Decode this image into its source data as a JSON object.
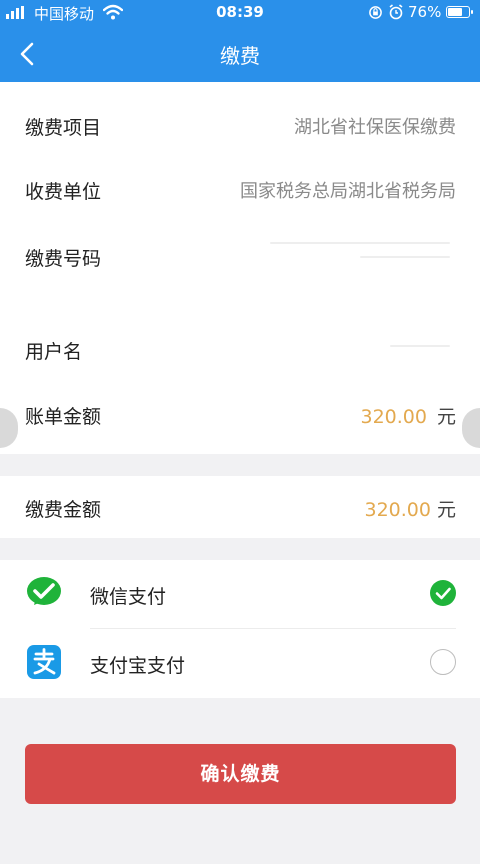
{
  "status_bar": {
    "carrier": "中国移动",
    "time": "08:39",
    "battery_text": "76%",
    "battery_level": 0.76
  },
  "nav": {
    "title": "缴费"
  },
  "bill": {
    "item_label": "缴费项目",
    "item_value": "湖北省社保医保缴费",
    "payee_label": "收费单位",
    "payee_value": "国家税务总局湖北省税务局",
    "number_label": "缴费号码",
    "username_label": "用户名",
    "bill_amount_label": "账单金额",
    "bill_amount_value": "320.00",
    "bill_amount_unit": "元"
  },
  "payment": {
    "amount_label": "缴费金额",
    "amount_value": "320.00",
    "amount_unit": "元"
  },
  "methods": [
    {
      "label": "微信支付",
      "icon": "wechat-pay-icon",
      "selected": true
    },
    {
      "label": "支付宝支付",
      "icon": "alipay-icon",
      "selected": false
    }
  ],
  "confirm_label": "确认缴费",
  "colors": {
    "header": "#2a90ea",
    "amount": "#e3a94f",
    "confirm": "#d64a49",
    "wechat": "#1fb33a",
    "alipay": "#1a9ae6"
  }
}
